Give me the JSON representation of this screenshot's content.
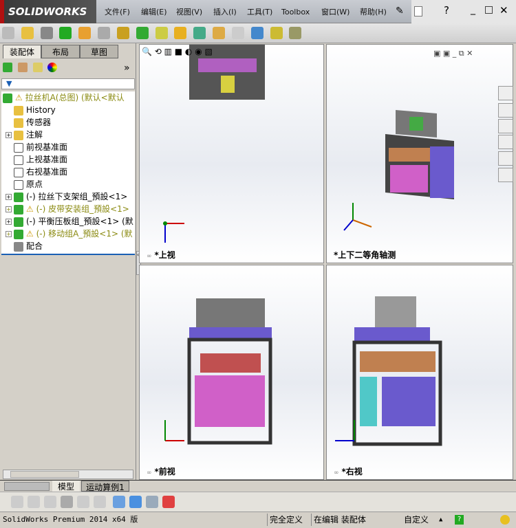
{
  "app": {
    "logo": "SOLIDWORKS"
  },
  "menu": [
    "文件(F)",
    "编辑(E)",
    "视图(V)",
    "插入(I)",
    "工具(T)",
    "Toolbox",
    "窗口(W)",
    "帮助(H)"
  ],
  "panel": {
    "tabs": [
      "装配体",
      "布局",
      "草图"
    ],
    "expand": "»"
  },
  "tree": [
    {
      "label": "拉丝机A(总图)  (默认<默认",
      "warn": true
    },
    {
      "label": "History"
    },
    {
      "label": "传感器"
    },
    {
      "label": "注解",
      "plus": true
    },
    {
      "label": "前视基准面"
    },
    {
      "label": "上视基准面"
    },
    {
      "label": "右视基准面"
    },
    {
      "label": "原点"
    },
    {
      "label": "(-) 拉丝下支架组_預設<1>",
      "plus": true
    },
    {
      "label": "(-) 皮带安装组_預設<1>",
      "plus": true,
      "warn": true
    },
    {
      "label": "(-) 平衡压板组_預設<1> (默",
      "plus": true
    },
    {
      "label": "(-) 移动组A_預設<1> (默",
      "plus": true,
      "warn": true
    },
    {
      "label": "配合"
    }
  ],
  "views": {
    "top": "*上视",
    "iso": "*上下二等角轴测",
    "front": "*前视",
    "right": "*右视"
  },
  "bottom_tabs": [
    "模型",
    "运动算例1"
  ],
  "status": {
    "product": "SolidWorks Premium 2014 x64 版",
    "defined": "完全定义",
    "editing": "在编辑 装配体",
    "units": "自定义"
  },
  "colors": {
    "accent": "#1a5fb4",
    "purple": "#6a5acd",
    "magenta": "#d060c8"
  }
}
